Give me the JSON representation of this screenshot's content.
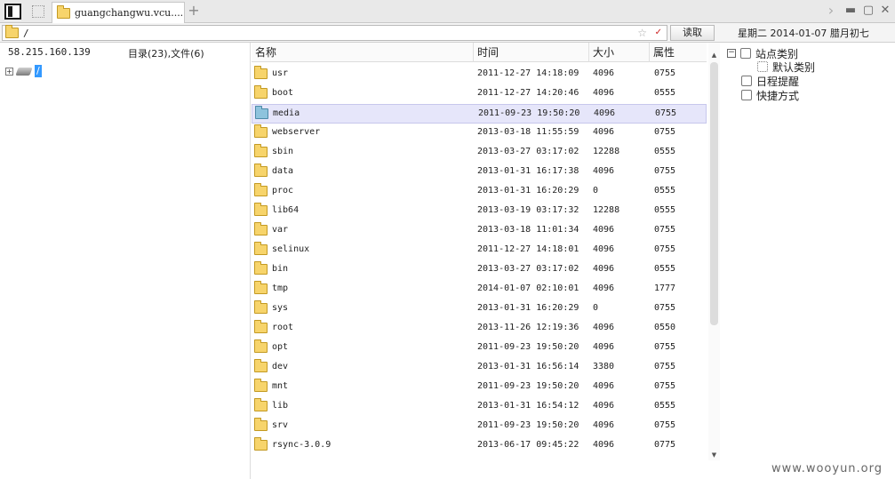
{
  "tabbar": {
    "tab_title": "guangchangwu.vcu....",
    "new_tab": "+",
    "next": "›",
    "minimize": "▬",
    "maximize": "▢",
    "close": "✕"
  },
  "address": {
    "path": "/",
    "star": "☆",
    "dropdown": "✓",
    "read_label": "读取",
    "date_text": "星期二  2014-01-07  腊月初七"
  },
  "left": {
    "ip": "58.215.160.139",
    "count": "目录(23),文件(6)",
    "tree_root": "/"
  },
  "columns": {
    "name": "名称",
    "time": "时间",
    "size": "大小",
    "attr": "属性"
  },
  "files": [
    {
      "name": "usr",
      "time": "2011-12-27 14:18:09",
      "size": "4096",
      "attr": "0755"
    },
    {
      "name": "boot",
      "time": "2011-12-27 14:20:46",
      "size": "4096",
      "attr": "0555"
    },
    {
      "name": "media",
      "time": "2011-09-23 19:50:20",
      "size": "4096",
      "attr": "0755"
    },
    {
      "name": "webserver",
      "time": "2013-03-18 11:55:59",
      "size": "4096",
      "attr": "0755"
    },
    {
      "name": "sbin",
      "time": "2013-03-27 03:17:02",
      "size": "12288",
      "attr": "0555"
    },
    {
      "name": "data",
      "time": "2013-01-31 16:17:38",
      "size": "4096",
      "attr": "0755"
    },
    {
      "name": "proc",
      "time": "2013-01-31 16:20:29",
      "size": "0",
      "attr": "0555"
    },
    {
      "name": "lib64",
      "time": "2013-03-19 03:17:32",
      "size": "12288",
      "attr": "0555"
    },
    {
      "name": "var",
      "time": "2013-03-18 11:01:34",
      "size": "4096",
      "attr": "0755"
    },
    {
      "name": "selinux",
      "time": "2011-12-27 14:18:01",
      "size": "4096",
      "attr": "0755"
    },
    {
      "name": "bin",
      "time": "2013-03-27 03:17:02",
      "size": "4096",
      "attr": "0555"
    },
    {
      "name": "tmp",
      "time": "2014-01-07 02:10:01",
      "size": "4096",
      "attr": "1777"
    },
    {
      "name": "sys",
      "time": "2013-01-31 16:20:29",
      "size": "0",
      "attr": "0755"
    },
    {
      "name": "root",
      "time": "2013-11-26 12:19:36",
      "size": "4096",
      "attr": "0550"
    },
    {
      "name": "opt",
      "time": "2011-09-23 19:50:20",
      "size": "4096",
      "attr": "0755"
    },
    {
      "name": "dev",
      "time": "2013-01-31 16:56:14",
      "size": "3380",
      "attr": "0755"
    },
    {
      "name": "mnt",
      "time": "2011-09-23 19:50:20",
      "size": "4096",
      "attr": "0755"
    },
    {
      "name": "lib",
      "time": "2013-01-31 16:54:12",
      "size": "4096",
      "attr": "0555"
    },
    {
      "name": "srv",
      "time": "2011-09-23 19:50:20",
      "size": "4096",
      "attr": "0755"
    },
    {
      "name": "rsync-3.0.9",
      "time": "2013-06-17 09:45:22",
      "size": "4096",
      "attr": "0775"
    }
  ],
  "selected_index": 2,
  "right": {
    "site_category": "站点类别",
    "default_category": "默认类别",
    "schedule": "日程提醒",
    "shortcut": "快捷方式",
    "collapse": "−"
  },
  "watermark": "www.wooyun.org",
  "colors": {
    "selection": "#3399ff",
    "row_selected": "#e6e6fa",
    "folder": "#f7d46b"
  }
}
